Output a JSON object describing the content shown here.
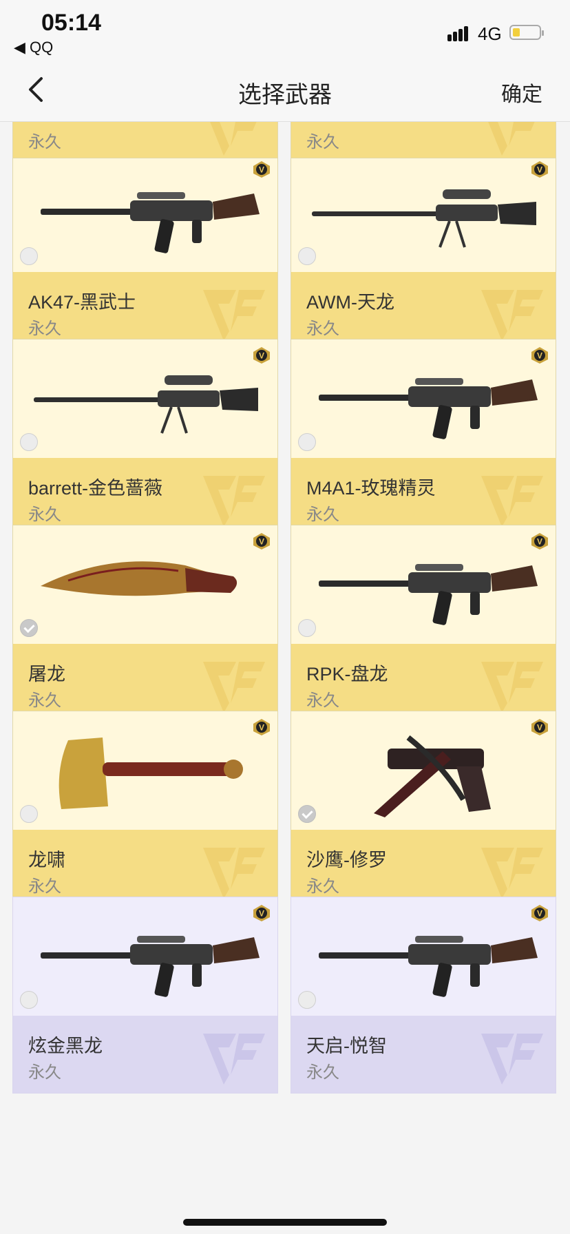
{
  "status_bar": {
    "time": "05:14",
    "back_app": "◀ QQ",
    "network": "4G"
  },
  "nav": {
    "title": "选择武器",
    "confirm": "确定"
  },
  "partial_row": [
    {
      "duration": "永久"
    },
    {
      "duration": "永久"
    }
  ],
  "cards": [
    {
      "name": "AK47-黑武士",
      "duration": "永久",
      "selected": false,
      "theme": "gold",
      "icon": "rifle-icon"
    },
    {
      "name": "AWM-天龙",
      "duration": "永久",
      "selected": false,
      "theme": "gold",
      "icon": "sniper-icon"
    },
    {
      "name": "barrett-金色蔷薇",
      "duration": "永久",
      "selected": false,
      "theme": "gold",
      "icon": "sniper-icon"
    },
    {
      "name": "M4A1-玫瑰精灵",
      "duration": "永久",
      "selected": false,
      "theme": "gold",
      "icon": "rifle-icon"
    },
    {
      "name": "屠龙",
      "duration": "永久",
      "selected": true,
      "theme": "gold",
      "icon": "knife-icon"
    },
    {
      "name": "RPK-盘龙",
      "duration": "永久",
      "selected": false,
      "theme": "gold",
      "icon": "rifle-icon"
    },
    {
      "name": "龙啸",
      "duration": "永久",
      "selected": false,
      "theme": "gold",
      "icon": "axe-icon"
    },
    {
      "name": "沙鹰-修罗",
      "duration": "永久",
      "selected": true,
      "theme": "gold",
      "icon": "pistol-icon"
    },
    {
      "name": "炫金黑龙",
      "duration": "永久",
      "selected": false,
      "theme": "purple",
      "icon": "rifle-icon"
    },
    {
      "name": "天启-悦智",
      "duration": "永久",
      "selected": false,
      "theme": "purple",
      "icon": "rifle-icon"
    }
  ],
  "colors": {
    "gold_info": "#f5dd85",
    "gold_bg": "#fff8dc",
    "purple_info": "#dcd8f1",
    "purple_bg": "#efedfb"
  }
}
